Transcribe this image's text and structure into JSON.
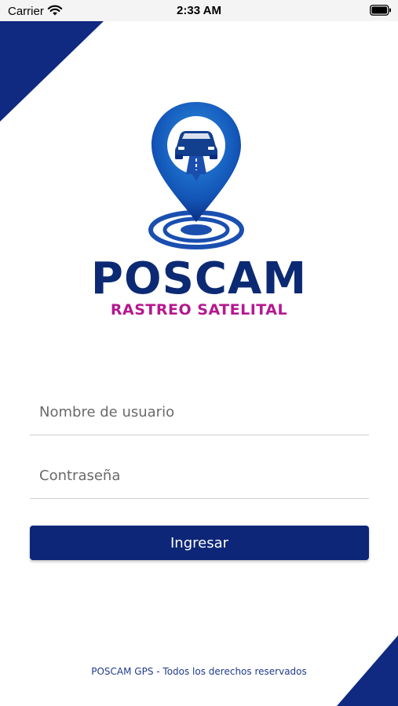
{
  "status_bar": {
    "carrier": "Carrier",
    "time": "2:33 AM"
  },
  "brand": {
    "title": "POSCAM",
    "subtitle": "RASTREO SATELITAL"
  },
  "form": {
    "username_placeholder": "Nombre de usuario",
    "password_placeholder": "Contraseña",
    "submit_label": "Ingresar"
  },
  "footer": {
    "text": "POSCAM GPS - Todos los derechos reservados"
  },
  "colors": {
    "primary": "#0d2677",
    "accent": "#b5188f",
    "corner": "#0f2a80"
  }
}
